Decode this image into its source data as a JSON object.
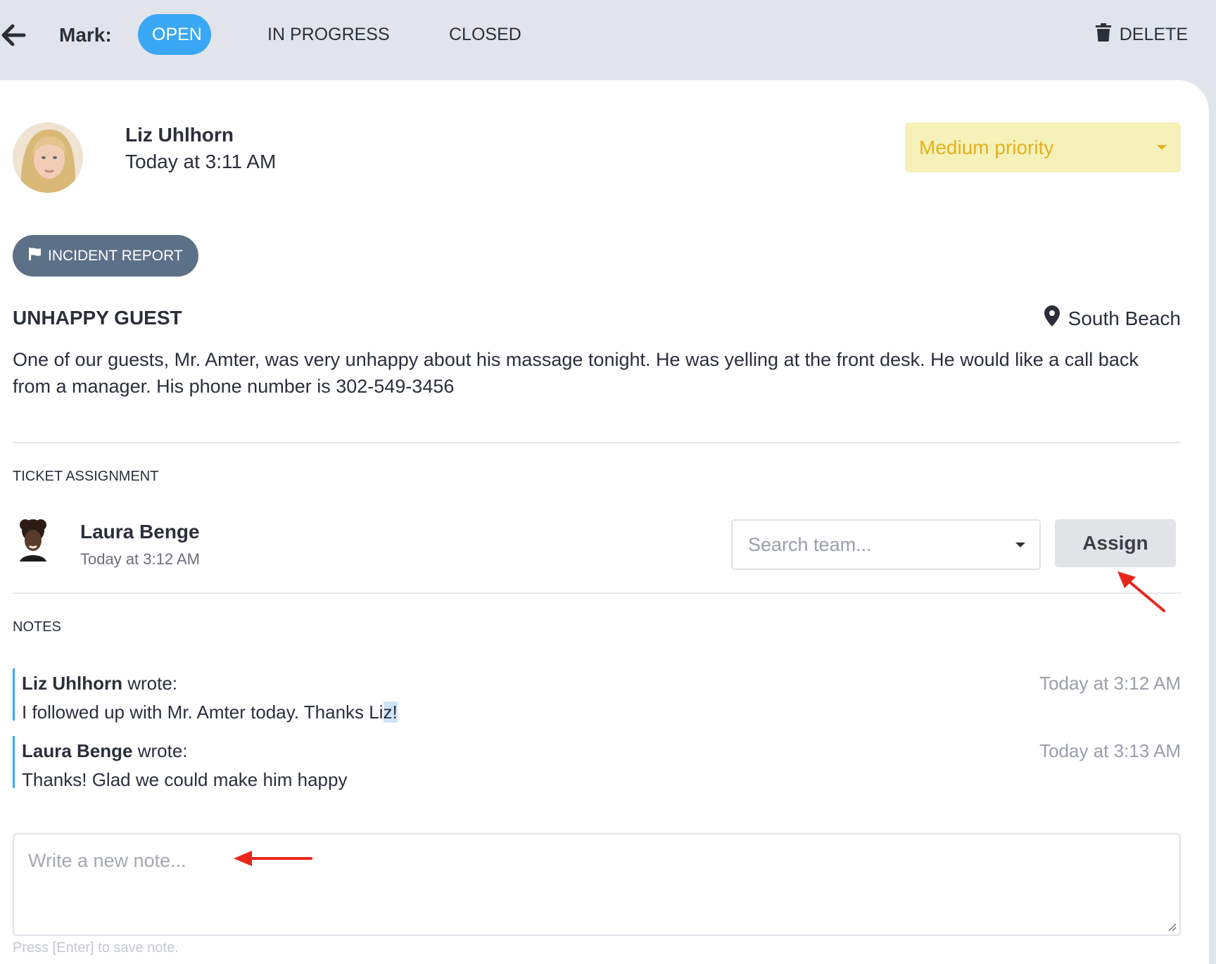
{
  "toolbar": {
    "mark_label": "Mark:",
    "tabs": [
      {
        "label": "OPEN",
        "active": true
      },
      {
        "label": "IN PROGRESS",
        "active": false
      },
      {
        "label": "CLOSED",
        "active": false
      }
    ],
    "delete_label": "DELETE"
  },
  "ticket": {
    "author": {
      "name": "Liz Uhlhorn",
      "time": "Today at 3:11 AM"
    },
    "priority": "Medium priority",
    "category": "INCIDENT REPORT",
    "title": "UNHAPPY GUEST",
    "location": "South Beach",
    "description": "One of our guests, Mr. Amter, was very unhappy about his massage tonight. He was yelling at the front desk. He would like a call back from a manager. His phone number is 302-549-3456"
  },
  "assignment": {
    "section_label": "TICKET ASSIGNMENT",
    "assignee": {
      "name": "Laura Benge",
      "time": "Today at 3:12 AM"
    },
    "search_placeholder": "Search team...",
    "assign_label": "Assign"
  },
  "notes": {
    "section_label": "NOTES",
    "items": [
      {
        "author": "Liz Uhlhorn",
        "wrote": "wrote:",
        "text_main": "I followed up with Mr. Amter today. Thanks Li",
        "text_highlight": "z!",
        "time": "Today at 3:12 AM"
      },
      {
        "author": "Laura Benge",
        "wrote": "wrote:",
        "text_main": "Thanks! Glad we could make him happy",
        "text_highlight": "",
        "time": "Today at 3:13 AM"
      }
    ],
    "input_placeholder": "Write a new note...",
    "hint": "Press [Enter] to save note."
  },
  "colors": {
    "accent": "#3aa7f5",
    "priority_bg": "#f6f1b9",
    "priority_text": "#e3b11a",
    "category_bg": "#5c7087",
    "annotation_arrow": "#e8261c"
  },
  "icons": [
    "arrow-left-icon",
    "trash-icon",
    "flag-icon",
    "map-pin-icon",
    "caret-down-icon"
  ]
}
